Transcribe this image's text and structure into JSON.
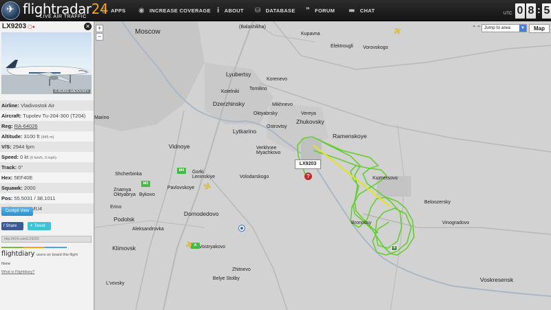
{
  "header": {
    "logo_main": "flightradar",
    "logo_accent": "24",
    "logo_sub": "LIVE AIR TRAFFIC",
    "nav": [
      {
        "label": "APPS",
        "icon": "▯"
      },
      {
        "label": "INCREASE COVERAGE",
        "icon": "◉"
      },
      {
        "label": "ABOUT",
        "icon": "i"
      },
      {
        "label": "DATABASE",
        "icon": "⛁"
      },
      {
        "label": "FORUM",
        "icon": "❞"
      },
      {
        "label": "CHAT",
        "icon": "▬"
      }
    ],
    "clock": {
      "utc_label": "UTC",
      "digits": [
        "0",
        "8",
        "5"
      ]
    }
  },
  "sidebar": {
    "flight_id": "LX9203",
    "photo_credit": "© BORIS SADOVSKY",
    "rows": [
      {
        "key": "Airline:",
        "value": "Vladivostok Air",
        "small": ""
      },
      {
        "key": "Aircraft:",
        "value": "Tupolev Tu-204-300 (T204)",
        "small": ""
      },
      {
        "key": "Reg:",
        "value": "RA-64026",
        "small": ""
      },
      {
        "key": "Altitude:",
        "value": "3100 ft",
        "small": "(945 m)"
      },
      {
        "key": "V/S:",
        "value": "2944 fpm",
        "small": ""
      },
      {
        "key": "Speed:",
        "value": "0 kt",
        "small": "(0 km/h, 0 mph)"
      },
      {
        "key": "Track:",
        "value": "0°",
        "small": ""
      },
      {
        "key": "Hex:",
        "value": "5EF40E",
        "small": ""
      },
      {
        "key": "Squawk:",
        "value": "2000",
        "small": ""
      },
      {
        "key": "Pos:",
        "value": "55.5031 / 38.1011",
        "small": ""
      },
      {
        "key": "Radar:",
        "value": "T-UUMU4",
        "small": ""
      }
    ],
    "cockpit_label": "Cockpit View",
    "share_label": "Share",
    "tweet_label": "Tweet",
    "short_link": "http://fr24.com/LX9203",
    "flightdiary_logo": "flightdiary",
    "flightdiary_text": "users on board this flight",
    "flightdiary_none": "None",
    "flightdiary_link": "What is Flightdiary?"
  },
  "map": {
    "jump_label": "Jump to area",
    "map_type": "Map",
    "zoom_in": "+",
    "zoom_out": "−",
    "callout": "LX9203",
    "track_color": "#66cc33",
    "direct_line_color": "#e4e41a",
    "labels": [
      {
        "text": "Moscow",
        "cls": "big"
      },
      {
        "text": "(Balashikha)",
        "cls": ""
      },
      {
        "text": "Kupavna",
        "cls": ""
      },
      {
        "text": "Elektrougli",
        "cls": ""
      },
      {
        "text": "Vorovskogo",
        "cls": ""
      },
      {
        "text": "Lyubertsy",
        "cls": "mid"
      },
      {
        "text": "Korenevo",
        "cls": ""
      },
      {
        "text": "Kotelniki",
        "cls": ""
      },
      {
        "text": "Tomilino",
        "cls": ""
      },
      {
        "text": "Dzerzhinsky",
        "cls": "mid"
      },
      {
        "text": "Mikhnevo",
        "cls": ""
      },
      {
        "text": "Vereya",
        "cls": ""
      },
      {
        "text": "Oktyabrsky",
        "cls": ""
      },
      {
        "text": "Ostrovtsy",
        "cls": ""
      },
      {
        "text": "Zhukovsky",
        "cls": "mid"
      },
      {
        "text": "Lytkarino",
        "cls": "mid"
      },
      {
        "text": "Ramenskoye",
        "cls": "mid"
      },
      {
        "text": "Vidnoye",
        "cls": "mid"
      },
      {
        "text": "Verkhnee Myachkovo",
        "cls": ""
      },
      {
        "text": "Gorki Leninskiye",
        "cls": ""
      },
      {
        "text": "Volodarskogo",
        "cls": ""
      },
      {
        "text": "Kuznetsovo",
        "cls": ""
      },
      {
        "text": "Shcherbinka",
        "cls": ""
      },
      {
        "text": "Znamya Oktyabrya",
        "cls": ""
      },
      {
        "text": "Pavlovskoye",
        "cls": ""
      },
      {
        "text": "Bykovo",
        "cls": ""
      },
      {
        "text": "Beloozersky",
        "cls": ""
      },
      {
        "text": "Erino",
        "cls": ""
      },
      {
        "text": "Podolsk",
        "cls": "mid"
      },
      {
        "text": "Domodedovo",
        "cls": "mid"
      },
      {
        "text": "Bronnitsy",
        "cls": ""
      },
      {
        "text": "Vinogradovo",
        "cls": ""
      },
      {
        "text": "Aleksandrovka",
        "cls": ""
      },
      {
        "text": "Klimovsk",
        "cls": "mid"
      },
      {
        "text": "Vostryakovo",
        "cls": ""
      },
      {
        "text": "Zhitnevo",
        "cls": ""
      },
      {
        "text": "Belye Stolby",
        "cls": ""
      },
      {
        "text": "Voskresensk",
        "cls": "mid"
      },
      {
        "text": "L'vovsky",
        "cls": ""
      },
      {
        "text": "Marino",
        "cls": ""
      },
      {
        "text": "Tomilino",
        "cls": ""
      }
    ]
  }
}
